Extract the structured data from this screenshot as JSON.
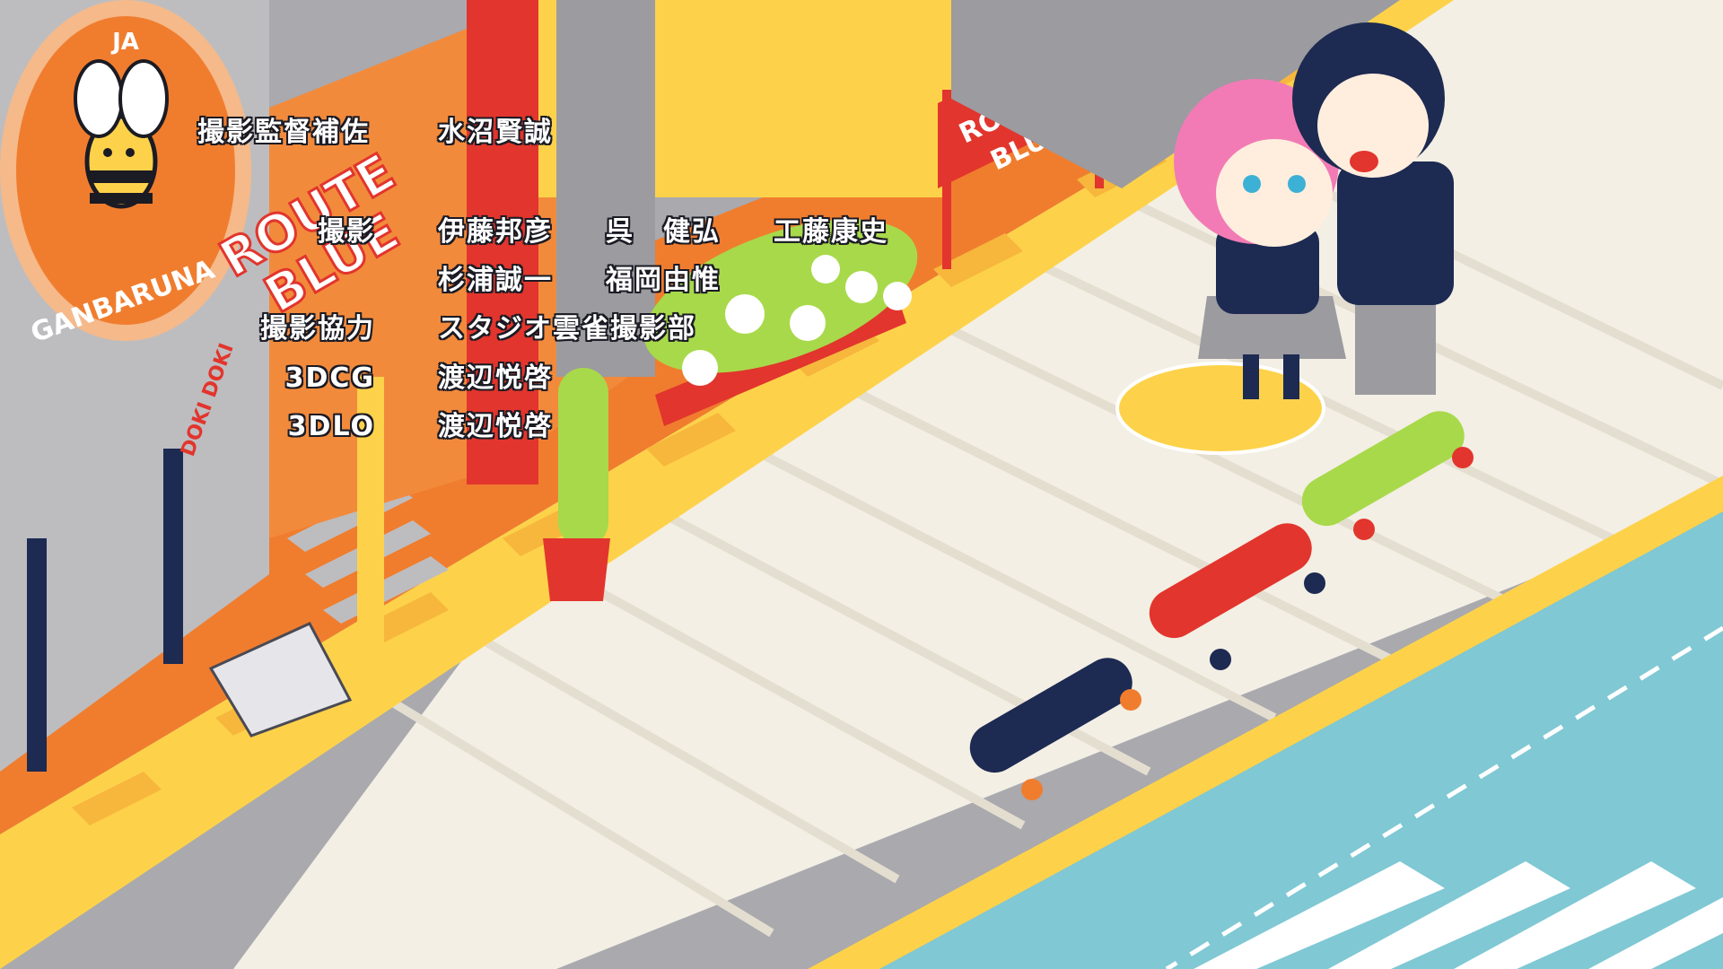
{
  "colors": {
    "road_orange": "#f07d2e",
    "curb_yellow": "#fdd24a",
    "sidewalk_cream": "#f3efe4",
    "building_gray": "#a9a9ae",
    "water_blue": "#7fc8d4",
    "navy": "#1d2a52",
    "red": "#e2352d",
    "lime": "#a8d94a",
    "pink_hair": "#f27bb5",
    "credit_text": "#ffffff",
    "credit_outline": "#1b1b24"
  },
  "signs": {
    "bee_logo_top": "JA",
    "bee_logo_bottom": "GANBARUNA",
    "route_blue_top": "ROUTE",
    "route_blue_bottom": "BLUE",
    "doki_doki": "DOKI DOKI"
  },
  "credits": [
    {
      "role": "撮影監督補佐",
      "names": [
        "水沼賢誠"
      ]
    },
    {
      "role": "撮影",
      "names": [
        "伊藤邦彦",
        "呉　健弘",
        "工藤康史"
      ]
    },
    {
      "role": "",
      "names": [
        "杉浦誠一",
        "福岡由惟"
      ]
    },
    {
      "role": "撮影協力",
      "names": [
        "スタジオ雲雀撮影部"
      ]
    },
    {
      "role": "3DCG",
      "names": [
        "渡辺悦啓"
      ]
    },
    {
      "role": "3DLO",
      "names": [
        "渡辺悦啓"
      ]
    }
  ]
}
